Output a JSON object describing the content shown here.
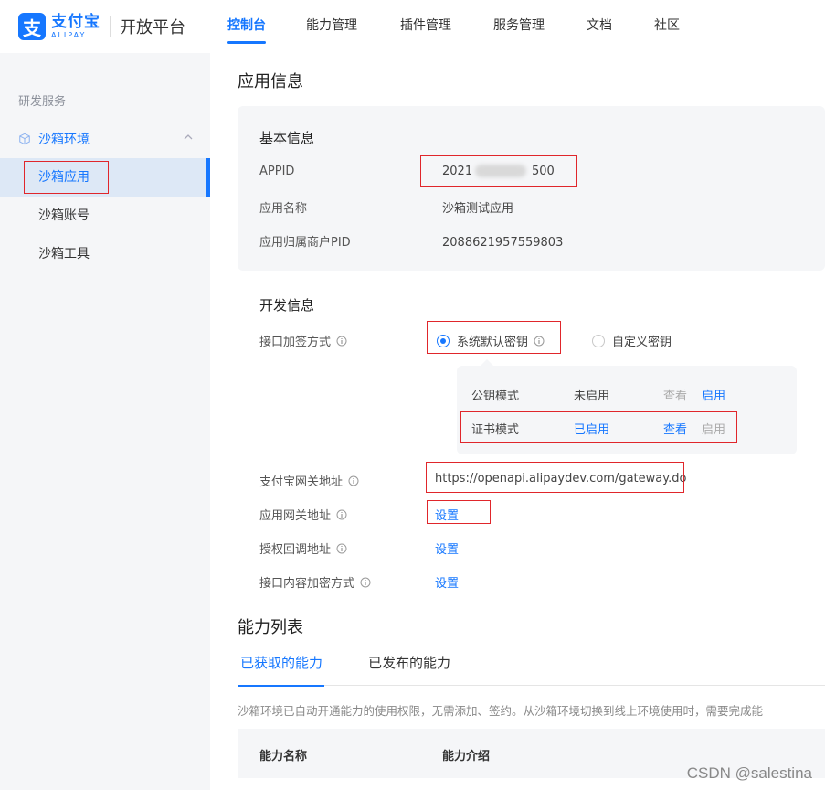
{
  "brand": {
    "logo_glyph": "支",
    "name_cn": "支付宝",
    "name_en": "ALIPAY",
    "platform": "开放平台",
    "color": "#1677ff"
  },
  "nav": {
    "items": [
      {
        "label": "控制台",
        "active": true
      },
      {
        "label": "能力管理"
      },
      {
        "label": "插件管理"
      },
      {
        "label": "服务管理"
      },
      {
        "label": "文档"
      },
      {
        "label": "社区"
      }
    ]
  },
  "sidebar": {
    "group_label": "研发服务",
    "parent": {
      "label": "沙箱环境",
      "icon": "cube-icon",
      "expand_icon": "chevron-up-icon"
    },
    "items": [
      {
        "label": "沙箱应用",
        "active": true
      },
      {
        "label": "沙箱账号"
      },
      {
        "label": "沙箱工具"
      }
    ]
  },
  "page_title": "应用信息",
  "basic_info": {
    "title": "基本信息",
    "appid_label": "APPID",
    "appid_prefix": "2021",
    "appid_suffix": "500",
    "app_name_label": "应用名称",
    "app_name": "沙箱测试应用",
    "pid_label": "应用归属商户PID",
    "pid": "2088621957559803"
  },
  "dev_info": {
    "title": "开发信息",
    "sign_label": "接口加签方式",
    "sign_default": "系统默认密钥",
    "sign_custom": "自定义密钥",
    "key_modes": [
      {
        "name": "公钥模式",
        "status": "未启用",
        "view": "查看",
        "enable": "启用"
      },
      {
        "name": "证书模式",
        "status": "已启用",
        "view": "查看",
        "enable": "启用"
      }
    ],
    "gateway_label": "支付宝网关地址",
    "gateway_url": "https://openapi.alipaydev.com/gateway.do",
    "app_gateway_label": "应用网关地址",
    "app_gateway_action": "设置",
    "callback_label": "授权回调地址",
    "callback_action": "设置",
    "encrypt_label": "接口内容加密方式",
    "encrypt_action": "设置"
  },
  "capability": {
    "title": "能力列表",
    "tabs": [
      {
        "label": "已获取的能力",
        "active": true
      },
      {
        "label": "已发布的能力"
      }
    ],
    "notice": "沙箱环境已自动开通能力的使用权限，无需添加、签约。从沙箱环境切换到线上环境使用时，需要完成能",
    "columns": [
      "能力名称",
      "能力介绍"
    ]
  },
  "watermark": "CSDN @salestina",
  "highlight_color": "#e0262b"
}
